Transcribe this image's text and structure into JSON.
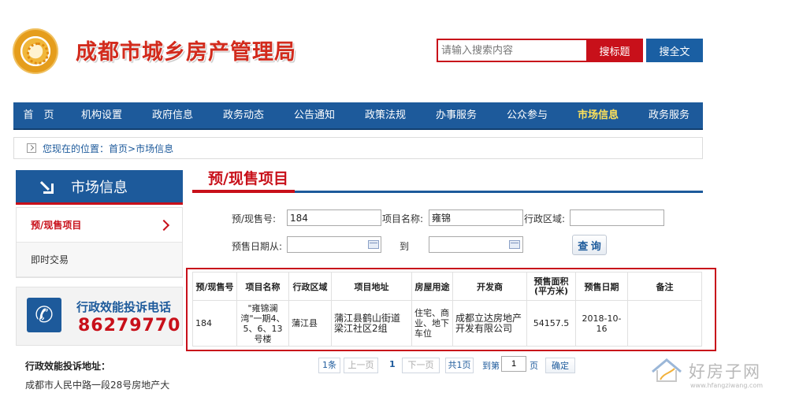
{
  "header": {
    "site_title": "成都市城乡房产管理局",
    "search_placeholder": "请输入搜索内容",
    "search_title_btn": "搜标题",
    "search_full_btn": "搜全文"
  },
  "nav": {
    "items": [
      {
        "label": "首　页",
        "active": false
      },
      {
        "label": "机构设置",
        "active": false
      },
      {
        "label": "政府信息",
        "active": false
      },
      {
        "label": "政务动态",
        "active": false
      },
      {
        "label": "公告通知",
        "active": false
      },
      {
        "label": "政策法规",
        "active": false
      },
      {
        "label": "办事服务",
        "active": false
      },
      {
        "label": "公众参与",
        "active": false
      },
      {
        "label": "市场信息",
        "active": true
      },
      {
        "label": "政务服务",
        "active": false
      }
    ]
  },
  "breadcrumb": {
    "prefix": "您现在的位置：",
    "home": "首页",
    "current": ">市场信息"
  },
  "sidebar": {
    "header": "市场信息",
    "items": [
      {
        "label": "预/现售项目",
        "active": true
      },
      {
        "label": "即时交易",
        "active": false
      }
    ],
    "hotline_label": "行政效能投诉电话",
    "hotline_number": "86279770",
    "address_label": "行政效能投诉地址：",
    "address_value": "成都市人民中路一段28号房地产大"
  },
  "main": {
    "title": "预/现售项目",
    "form": {
      "presale_no_label": "预/现售号:",
      "presale_no_value": "184",
      "project_name_label": "项目名称:",
      "project_name_value": "雍锦",
      "district_label": "行政区域:",
      "district_value": "",
      "date_from_label": "预售日期从:",
      "date_from_value": "",
      "date_to_label": "到",
      "date_to_value": "",
      "query_btn": "查 询"
    },
    "table": {
      "headers": [
        "预/现售号",
        "项目名称",
        "行政区域",
        "项目地址",
        "房屋用途",
        "开发商",
        "预售面积\n(平方米)",
        "预售日期",
        "备注"
      ],
      "rows": [
        [
          "184",
          "\"雍锦澜湾\"一期4、5、6、13号楼",
          "蒲江县",
          "蒲江县鹤山街道梁江社区2组",
          "住宅、商业、地下车位",
          "成都立达房地产开发有限公司",
          "54157.5",
          "2018-10-16",
          ""
        ]
      ]
    },
    "pager": {
      "first": "1条",
      "prev": "上一页",
      "current": "1",
      "next": "下一页",
      "total": "共1页",
      "goto_label": "到第",
      "goto_value": "1",
      "page_unit": "页",
      "confirm": "确定"
    }
  },
  "watermark": {
    "text": "好房子网",
    "url": "www.hfangziwang.com"
  },
  "colors": {
    "brand_blue": "#1d5a9b",
    "brand_red": "#c8101a",
    "nav_active": "#ffe25a"
  }
}
